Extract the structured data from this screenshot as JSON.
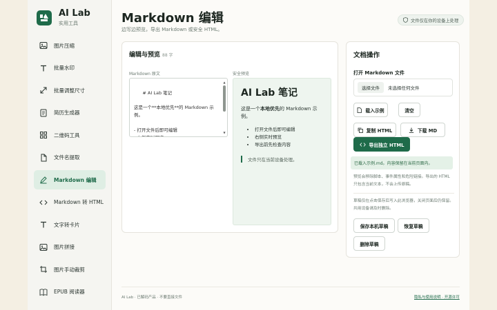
{
  "brand": {
    "name": "AI Lab",
    "subtitle": "实用工具"
  },
  "sidebar": {
    "items": [
      {
        "label": "图片压缩",
        "icon": "image-icon"
      },
      {
        "label": "批量水印",
        "icon": "text-t-icon"
      },
      {
        "label": "批量调整尺寸",
        "icon": "resize-icon"
      },
      {
        "label": "简历生成器",
        "icon": "document-icon"
      },
      {
        "label": "二维码工具",
        "icon": "qr-grid-icon"
      },
      {
        "label": "文件名提取",
        "icon": "file-icon"
      },
      {
        "label": "Markdown 编辑",
        "icon": "pen-icon",
        "active": true
      },
      {
        "label": "Markdown 转 HTML",
        "icon": "code-icon"
      },
      {
        "label": "文字转卡片",
        "icon": "text-t-icon"
      },
      {
        "label": "图片拼接",
        "icon": "image-icon"
      },
      {
        "label": "图片手动裁剪",
        "icon": "crop-icon"
      },
      {
        "label": "EPUB 阅读器",
        "icon": "book-icon"
      }
    ]
  },
  "header": {
    "title": "Markdown 编辑",
    "subtitle": "边写边预览，导出 Markdown 或安全 HTML。",
    "badge": "文件仅在你的设备上处理"
  },
  "editor": {
    "title": "编辑与预览",
    "char_count": "88 字",
    "source_label": "Markdown 原文",
    "source_text": "# AI Lab 笔记\n\n这是一个**本地优先**的 Markdown 示\n例。\n\n- 打开文件后即可编辑\n- 右侧实时预览\n- 导出前先检查内容",
    "preview_label": "安全预览",
    "preview": {
      "heading": "AI Lab 笔记",
      "para_before": "这是一个",
      "para_bold": "本地优先",
      "para_after": "的 Markdown 示例。",
      "list": [
        "打开文件后即可编辑",
        "右侧实时预览",
        "导出前先检查内容"
      ],
      "quote": "文件只在当前设备处理。"
    }
  },
  "ops": {
    "title": "文档操作",
    "open_label": "打开 Markdown 文件",
    "choose_file": "选择文件",
    "no_file": "未选择任何文件",
    "load_sample": "载入示例",
    "clear": "清空",
    "copy_html": "复制 HTML",
    "download_md": "下载 MD",
    "export_html": "导出独立 HTML",
    "notice": "已载入示例.md。内容保留在当前页面内。",
    "note1": "预览会移除脚本、事件属性和危险链接。导出的 HTML 只包含当前文本，不会上传原稿。",
    "note2": "草稿仅在点击保存后写入此浏览器，关闭页面后仍保留。共用设备请及时删除。",
    "save_draft": "保存本机草稿",
    "restore_draft": "恢复草稿",
    "delete_draft": "删除草稿"
  },
  "footer": {
    "left": "AI Lab · 已解码产品 · 不要直接文件",
    "right": "隐私与使用说明 · 开源许可"
  },
  "colors": {
    "accent": "#1f6b4a",
    "page_bg": "#f4efe3",
    "sidebar_bg": "#f5f5f1",
    "preview_bg": "#eef5ef"
  }
}
